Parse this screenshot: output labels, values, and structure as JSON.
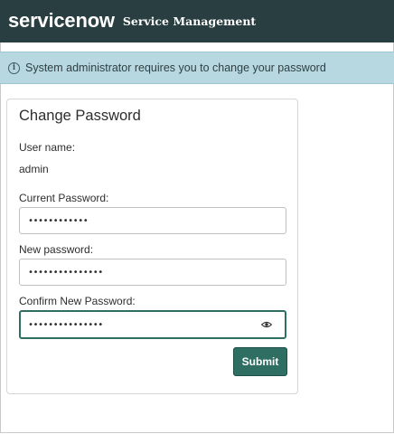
{
  "header": {
    "logo_text": "servicenow",
    "title": "Service Management"
  },
  "banner": {
    "icon": "info-icon",
    "message": "System administrator requires you to change your password"
  },
  "form": {
    "title": "Change Password",
    "username_label": "User name:",
    "username_value": "admin",
    "current_password_label": "Current Password:",
    "current_password_value": "••••••••••••",
    "new_password_label": "New password:",
    "new_password_value": "•••••••••••••••",
    "confirm_password_label": "Confirm New Password:",
    "confirm_password_value": "•••••••••••••••",
    "reveal_icon": "eye-icon",
    "submit_label": "Submit"
  },
  "colors": {
    "header_bg": "#293e40",
    "banner_bg": "#b7d8e1",
    "accent": "#2f6e63"
  }
}
